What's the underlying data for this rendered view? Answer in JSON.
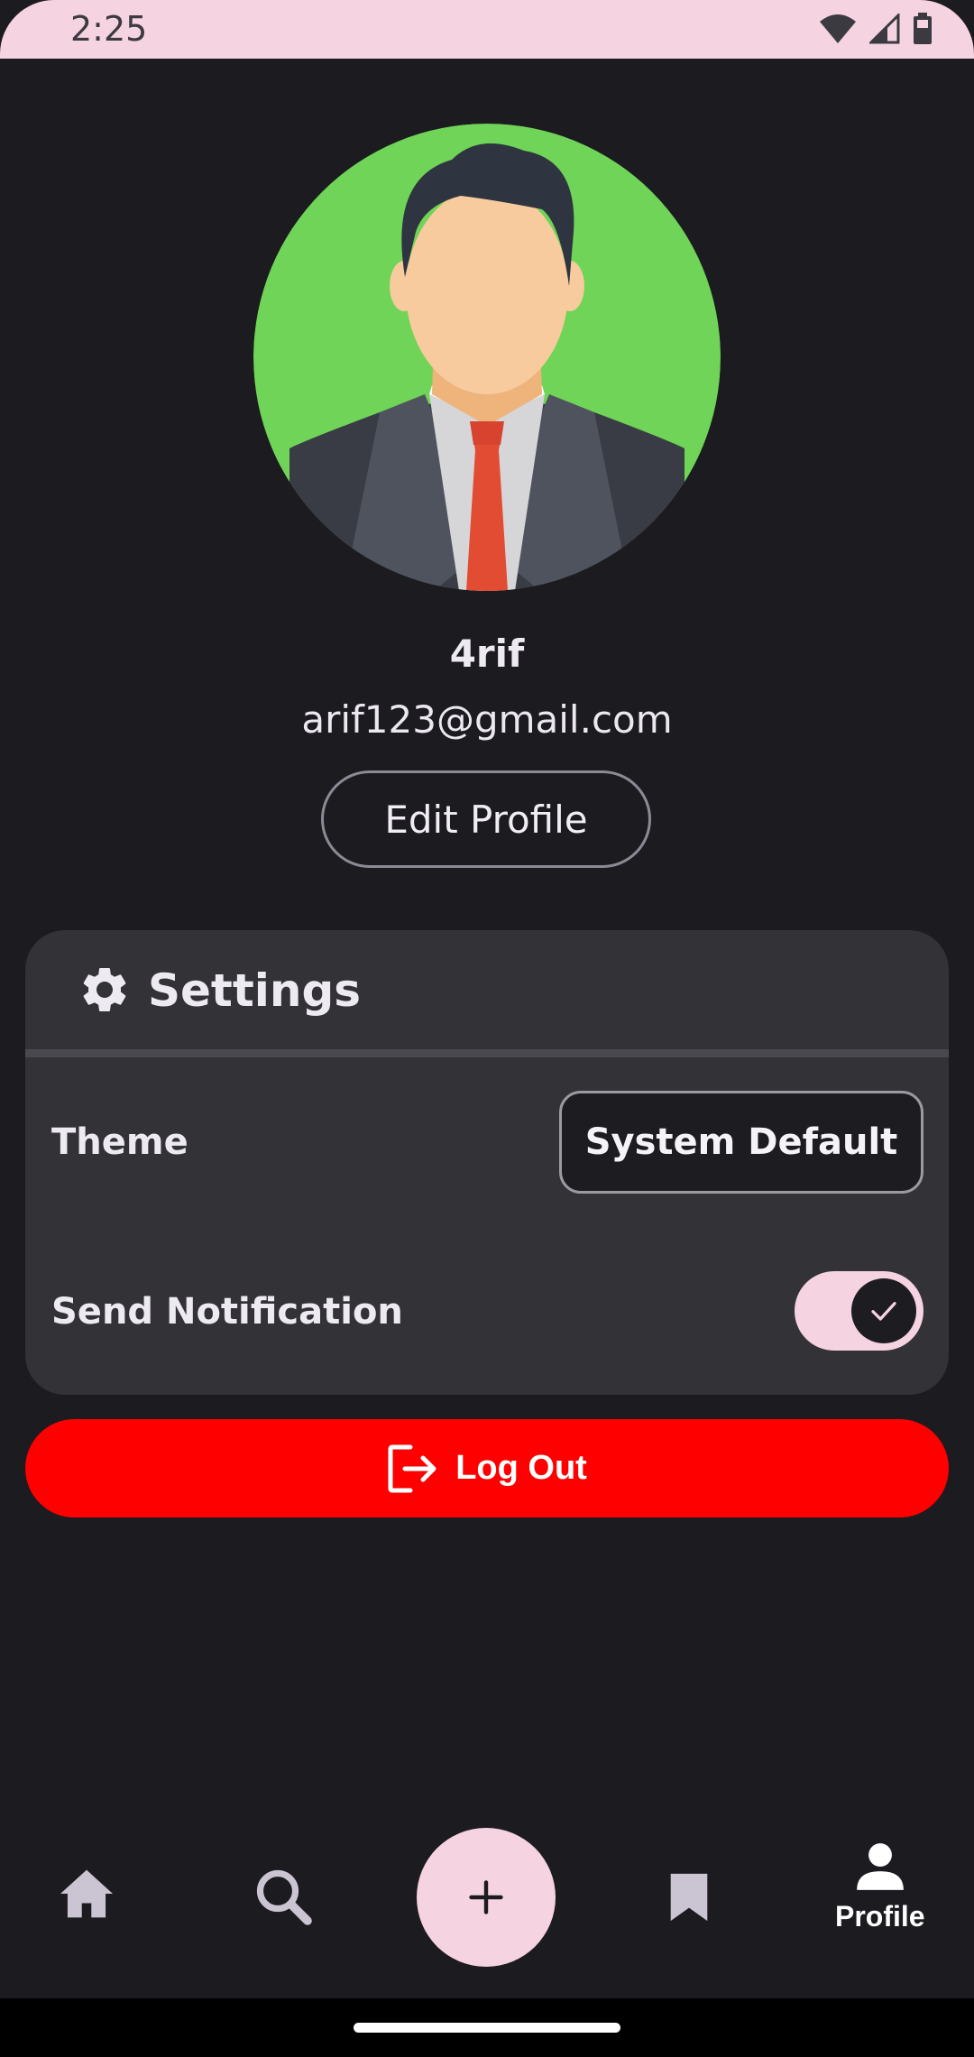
{
  "status_bar": {
    "time": "2:25"
  },
  "profile": {
    "name": "4rif",
    "email": "arif123@gmail.com",
    "edit_button": "Edit Profile"
  },
  "settings": {
    "title": "Settings",
    "theme_label": "Theme",
    "theme_value": "System Default",
    "notification_label": "Send Notification",
    "notification_enabled": true
  },
  "logout_label": "Log Out",
  "bottom_nav": {
    "items": [
      {
        "icon": "home-icon"
      },
      {
        "icon": "search-icon"
      },
      {
        "icon": "add-icon"
      },
      {
        "icon": "bookmark-icon"
      },
      {
        "icon": "profile-icon",
        "label": "Profile",
        "active": true
      }
    ]
  },
  "colors": {
    "background": "#1c1b20",
    "accent_pink": "#f6d3e0",
    "card": "#333237",
    "logout_red": "#ff0000",
    "avatar_bg": "#6fd457"
  }
}
